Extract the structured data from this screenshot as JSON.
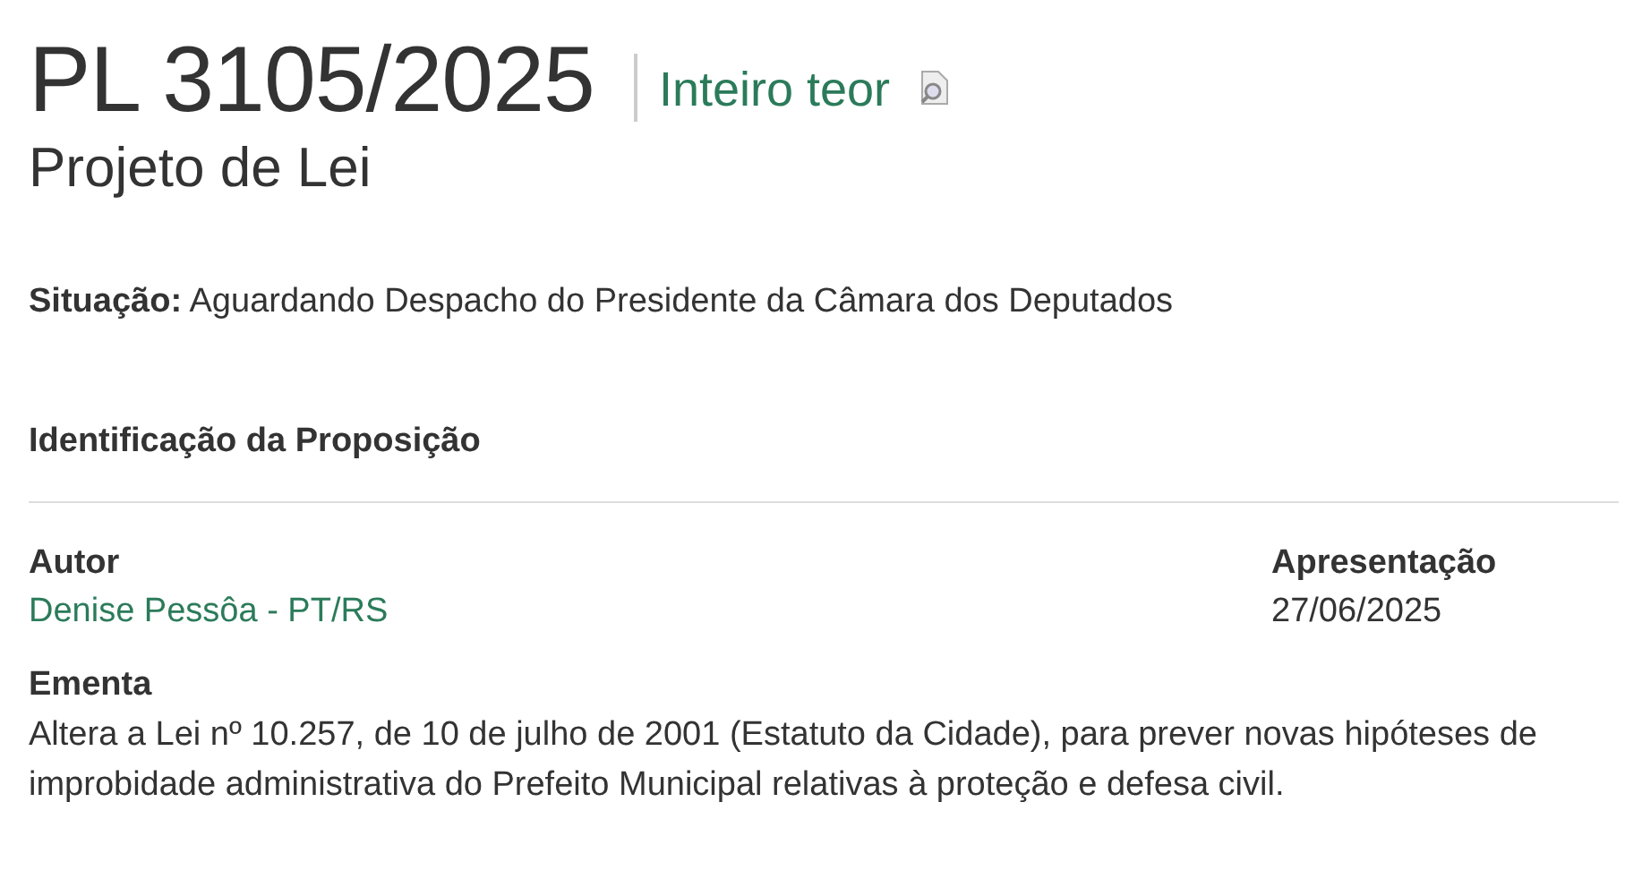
{
  "header": {
    "title": "PL 3105/2025",
    "full_text_link": "Inteiro teor",
    "subtitle": "Projeto de Lei"
  },
  "status": {
    "label": "Situação:",
    "value": "Aguardando Despacho do Presidente da Câmara dos Deputados"
  },
  "section": {
    "title": "Identificação da Proposição"
  },
  "fields": [
    {
      "label": "Autor",
      "value": "Denise Pessôa - PT/RS",
      "kind": "link"
    },
    {
      "label": "Apresentação",
      "value": "27/06/2025",
      "kind": "text"
    }
  ],
  "summary": {
    "label": "Ementa",
    "text": "Altera a Lei nº 10.257, de 10 de julho de 2001 (Estatuto da Cidade), para prever novas hipóteses de improbidade administrativa do Prefeito Municipal relativas à proteção e defesa civil."
  }
}
